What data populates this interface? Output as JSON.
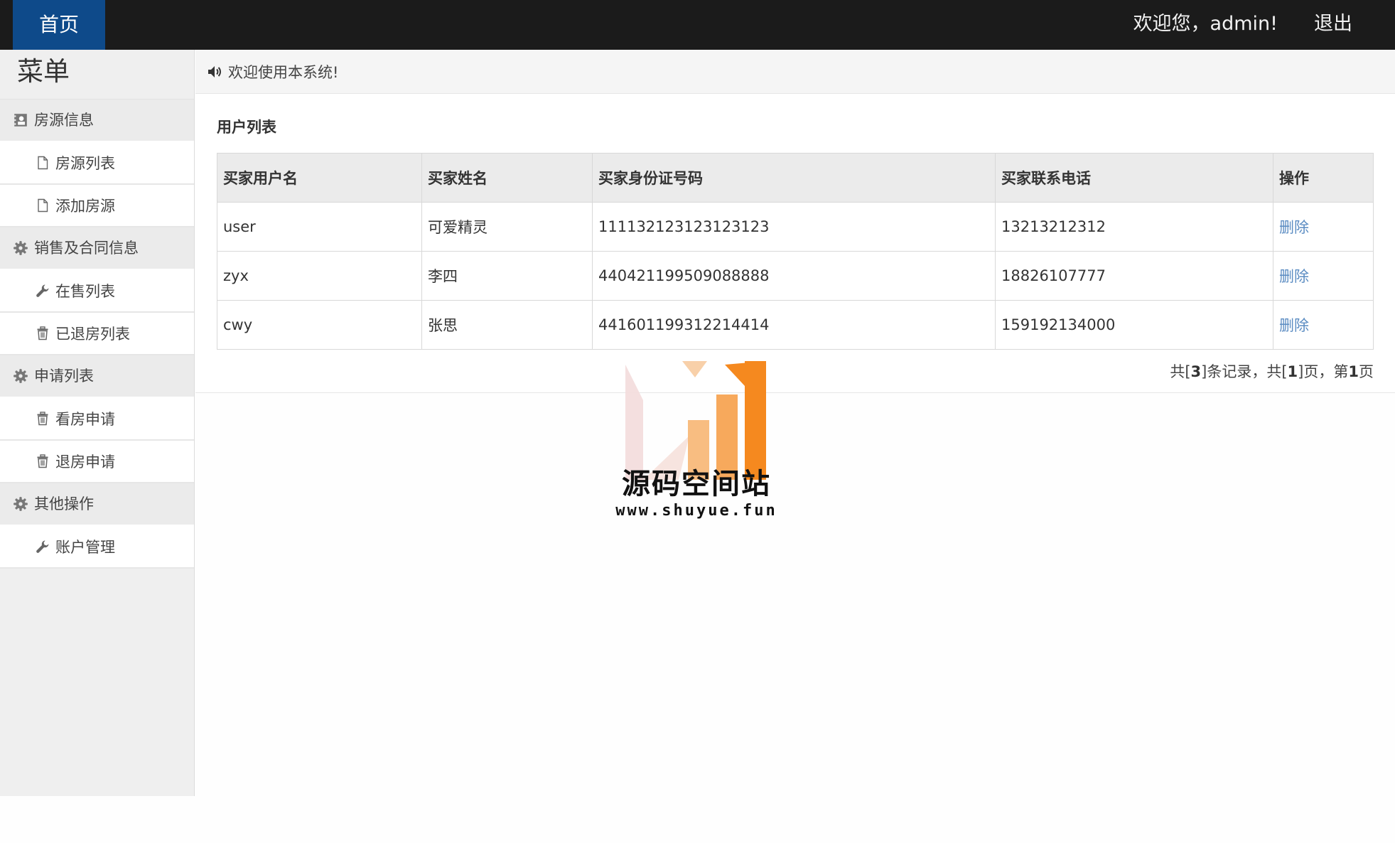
{
  "topbar": {
    "home_label": "首页",
    "welcome_text": "欢迎您，admin!",
    "logout_label": "退出"
  },
  "sidebar": {
    "title": "菜单",
    "groups": [
      {
        "label": "房源信息",
        "icon": "contact-card-icon",
        "items": [
          {
            "label": "房源列表",
            "icon": "file-icon"
          },
          {
            "label": "添加房源",
            "icon": "file-icon"
          }
        ]
      },
      {
        "label": "销售及合同信息",
        "icon": "gear-icon",
        "items": [
          {
            "label": "在售列表",
            "icon": "wrench-icon"
          },
          {
            "label": "已退房列表",
            "icon": "trash-icon"
          }
        ]
      },
      {
        "label": "申请列表",
        "icon": "gear-icon",
        "items": [
          {
            "label": "看房申请",
            "icon": "trash-icon"
          },
          {
            "label": "退房申请",
            "icon": "trash-icon"
          }
        ]
      },
      {
        "label": "其他操作",
        "icon": "gear-icon",
        "items": [
          {
            "label": "账户管理",
            "icon": "wrench-icon"
          }
        ]
      }
    ]
  },
  "notice": {
    "icon": "volume-icon",
    "text": "欢迎使用本系统!"
  },
  "panel": {
    "title": "用户列表",
    "columns": [
      "买家用户名",
      "买家姓名",
      "买家身份证号码",
      "买家联系电话",
      "操作"
    ],
    "rows": [
      {
        "username": "user",
        "name": "可爱精灵",
        "id_number": "111132123123123123",
        "phone": "13213212312",
        "action": "删除"
      },
      {
        "username": "zyx",
        "name": "李四",
        "id_number": "440421199509088888",
        "phone": "18826107777",
        "action": "删除"
      },
      {
        "username": "cwy",
        "name": "张思",
        "id_number": "441601199312214414",
        "phone": "159192134000",
        "action": "删除"
      }
    ],
    "pager": {
      "prefix": "共[",
      "total": "3",
      "mid1": "]条记录，共[",
      "pages": "1",
      "mid2": "]页，第",
      "current": "1",
      "suffix": "页"
    }
  },
  "watermark": {
    "title": "源码空间站",
    "url": "www.shuyue.fun"
  },
  "colors": {
    "topbar": "#1b1b1b",
    "home_active": "#0e4a8a",
    "link": "#5b8cc2",
    "watermark_orange": "#f5891f"
  }
}
